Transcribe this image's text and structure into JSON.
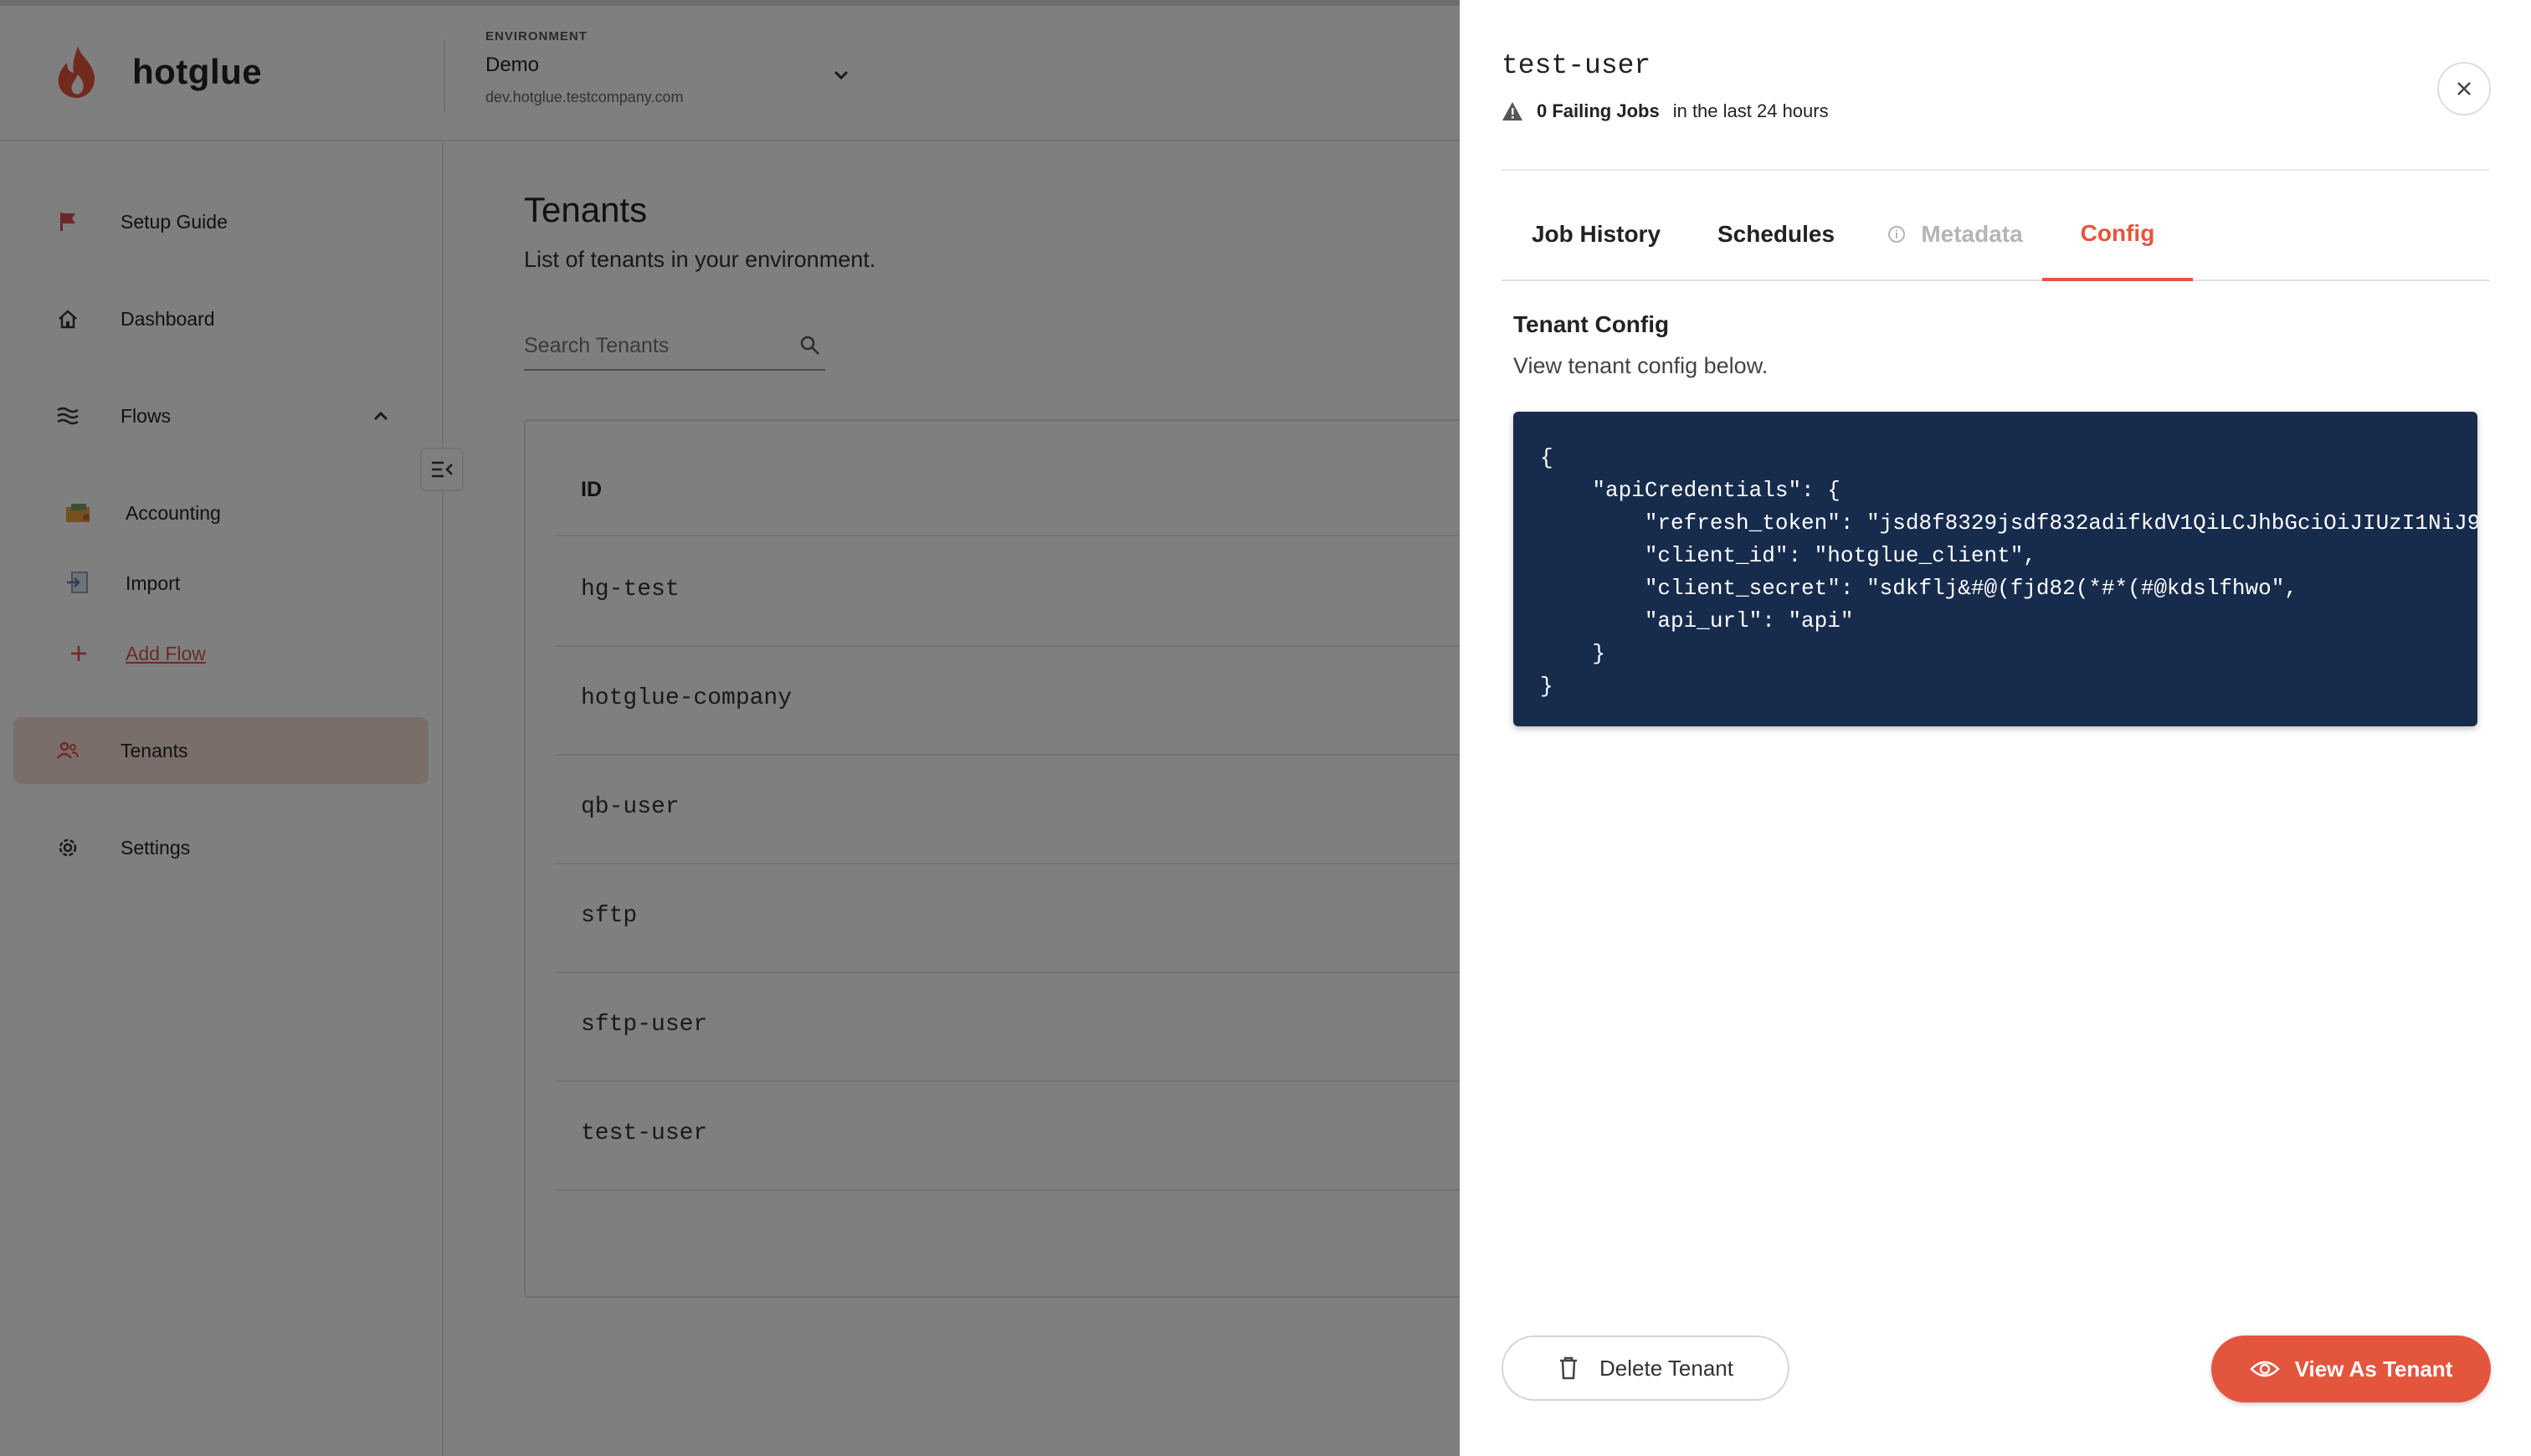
{
  "app": {
    "name": "hotglue",
    "environment": {
      "label": "ENVIRONMENT",
      "name": "Demo",
      "url": "dev.hotglue.testcompany.com"
    }
  },
  "sidebar": {
    "items": [
      {
        "label": "Setup Guide",
        "icon": "flag-icon"
      },
      {
        "label": "Dashboard",
        "icon": "home-icon"
      },
      {
        "label": "Flows",
        "icon": "flows-icon"
      },
      {
        "label": "Tenants",
        "icon": "users-icon"
      },
      {
        "label": "Settings",
        "icon": "gear-icon"
      }
    ],
    "flows": [
      {
        "label": "Accounting",
        "icon": "accounting-icon"
      },
      {
        "label": "Import",
        "icon": "import-icon"
      }
    ],
    "add_flow": "Add Flow",
    "accent_color": "#d9534f"
  },
  "main": {
    "title": "Tenants",
    "subtitle": "List of tenants in your environment.",
    "search_placeholder": "Search Tenants",
    "table": {
      "header": "ID",
      "rows": [
        "hg-test",
        "hotglue-company",
        "qb-user",
        "sftp",
        "sftp-user",
        "test-user"
      ]
    }
  },
  "drawer": {
    "title": "test-user",
    "failing_jobs": "0 Failing Jobs",
    "failing_suffix": "in the last 24 hours",
    "tabs": [
      "Job History",
      "Schedules",
      "Metadata",
      "Config"
    ],
    "active_tab": "Config",
    "config_title": "Tenant Config",
    "config_subtitle": "View tenant config below.",
    "config_json": "{\n    \"apiCredentials\": {\n        \"refresh_token\": \"jsd8f8329jsdf832adifkdV1QiLCJhbGciOiJIUzI1NiJ9\n        \"client_id\": \"hotglue_client\",\n        \"client_secret\": \"sdkflj&#@(fjd82(*#*(#@kdslfhwo\",\n        \"api_url\": \"api\"\n    }\n}",
    "delete_label": "Delete Tenant",
    "view_label": "View As Tenant",
    "accent_color": "#e4553e",
    "code_bg": "#172b4d"
  }
}
